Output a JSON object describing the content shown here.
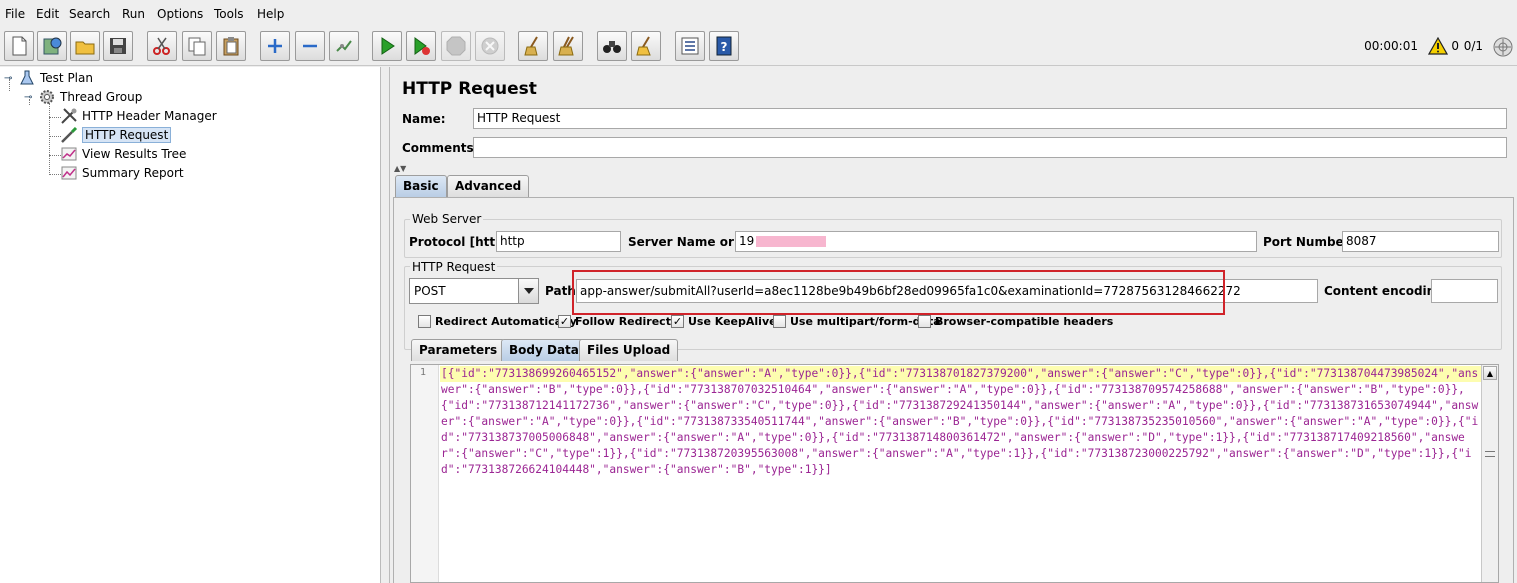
{
  "menu": [
    "File",
    "Edit",
    "Search",
    "Run",
    "Options",
    "Tools",
    "Help"
  ],
  "toolbar": {
    "timer": "00:00:01",
    "warnings": "0",
    "threads": "0/1"
  },
  "tree": {
    "items": [
      {
        "label": "Test Plan",
        "icon": "test-plan-icon"
      },
      {
        "label": "Thread Group",
        "icon": "thread-group-icon"
      },
      {
        "label": "HTTP Header Manager",
        "icon": "header-manager-icon"
      },
      {
        "label": "HTTP Request",
        "icon": "http-request-icon",
        "selected": true
      },
      {
        "label": "View Results Tree",
        "icon": "results-tree-icon"
      },
      {
        "label": "Summary Report",
        "icon": "summary-report-icon"
      }
    ]
  },
  "panel": {
    "title": "HTTP Request",
    "name_label": "Name:",
    "name_value": "HTTP Request",
    "comments_label": "Comments:",
    "comments_value": "",
    "tabs": [
      "Basic",
      "Advanced"
    ],
    "web_server": {
      "title": "Web Server",
      "protocol_label": "Protocol [http]:",
      "protocol_value": "http",
      "server_label": "Server Name or IP:",
      "server_value": "19",
      "port_label": "Port Number:",
      "port_value": "8087"
    },
    "http_request": {
      "title": "HTTP Request",
      "method": "POST",
      "path_label": "Path:",
      "path_value": "app-answer/submitAll?userId=a8ec1128be9b49b6bf28ed09965fa1c0&examinationId=772875631284662272",
      "encoding_label": "Content encoding:",
      "encoding_value": ""
    },
    "checkboxes": [
      {
        "label": "Redirect Automatically",
        "checked": false
      },
      {
        "label": "Follow Redirects",
        "checked": true
      },
      {
        "label": "Use KeepAlive",
        "checked": true
      },
      {
        "label": "Use multipart/form-data",
        "checked": false
      },
      {
        "label": "Browser-compatible headers",
        "checked": false
      }
    ],
    "body_tabs": [
      "Parameters",
      "Body Data",
      "Files Upload"
    ],
    "body": {
      "line_number": "1",
      "content": "[{\"id\":\"773138699260465152\",\"answer\":{\"answer\":\"A\",\"type\":0}},{\"id\":\"773138701827379200\",\"answer\":{\"answer\":\"C\",\"type\":0}},{\"id\":\"773138704473985024\",\"answer\":{\"answer\":\"B\",\"type\":0}},{\"id\":\"773138707032510464\",\"answer\":{\"answer\":\"A\",\"type\":0}},{\"id\":\"773138709574258688\",\"answer\":{\"answer\":\"B\",\"type\":0}},{\"id\":\"773138712141172736\",\"answer\":{\"answer\":\"C\",\"type\":0}},{\"id\":\"773138729241350144\",\"answer\":{\"answer\":\"A\",\"type\":0}},{\"id\":\"773138731653074944\",\"answer\":{\"answer\":\"A\",\"type\":0}},{\"id\":\"773138733540511744\",\"answer\":{\"answer\":\"B\",\"type\":0}},{\"id\":\"773138735235010560\",\"answer\":{\"answer\":\"A\",\"type\":0}},{\"id\":\"773138737005006848\",\"answer\":{\"answer\":\"A\",\"type\":0}},{\"id\":\"773138714800361472\",\"answer\":{\"answer\":\"D\",\"type\":1}},{\"id\":\"773138717409218560\",\"answer\":{\"answer\":\"C\",\"type\":1}},{\"id\":\"773138720395563008\",\"answer\":{\"answer\":\"A\",\"type\":1}},{\"id\":\"773138723000225792\",\"answer\":{\"answer\":\"D\",\"type\":1}},{\"id\":\"773138726624104448\",\"answer\":{\"answer\":\"B\",\"type\":1}}]"
    }
  }
}
